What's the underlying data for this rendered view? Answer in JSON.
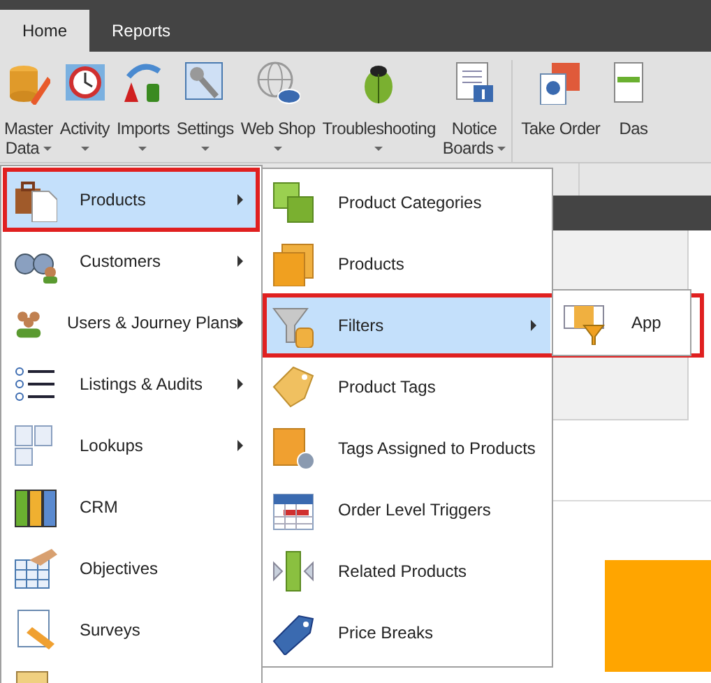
{
  "tabs": [
    {
      "label": "Home",
      "selected": true
    },
    {
      "label": "Reports",
      "selected": false
    }
  ],
  "ribbon": {
    "groups": [
      {
        "buttons": [
          {
            "lines": [
              "Master",
              "Data"
            ],
            "dropdown": true
          },
          {
            "lines": [
              "Activity"
            ],
            "dropdown": true
          },
          {
            "lines": [
              "Imports"
            ],
            "dropdown": true
          },
          {
            "lines": [
              "Settings"
            ],
            "dropdown": true
          },
          {
            "lines": [
              "Web Shop"
            ],
            "dropdown": true
          },
          {
            "lines": [
              "Troubleshooting"
            ],
            "dropdown": true
          },
          {
            "lines": [
              "Notice",
              "Boards"
            ],
            "dropdown": true
          }
        ]
      },
      {
        "buttons": [
          {
            "lines": [
              "Take Order"
            ],
            "dropdown": false
          },
          {
            "lines": [
              "Das"
            ],
            "dropdown": false
          }
        ]
      }
    ]
  },
  "menu": {
    "items": [
      {
        "label": "Products",
        "selected": true,
        "submenu": true,
        "highlighted": true
      },
      {
        "label": "Customers",
        "selected": false,
        "submenu": true,
        "highlighted": false
      },
      {
        "label": "Users & Journey Plans",
        "selected": false,
        "submenu": true,
        "highlighted": false
      },
      {
        "label": "Listings & Audits",
        "selected": false,
        "submenu": true,
        "highlighted": false
      },
      {
        "label": "Lookups",
        "selected": false,
        "submenu": true,
        "highlighted": false
      },
      {
        "label": "CRM",
        "selected": false,
        "submenu": false,
        "highlighted": false
      },
      {
        "label": "Objectives",
        "selected": false,
        "submenu": false,
        "highlighted": false
      },
      {
        "label": "Surveys",
        "selected": false,
        "submenu": false,
        "highlighted": false
      }
    ]
  },
  "submenu": {
    "items": [
      {
        "label": "Product Categories",
        "selected": false,
        "submenu": false,
        "highlighted": false
      },
      {
        "label": "Products",
        "selected": false,
        "submenu": false,
        "highlighted": false
      },
      {
        "label": "Filters",
        "selected": true,
        "submenu": true,
        "highlighted": true
      },
      {
        "label": "Product Tags",
        "selected": false,
        "submenu": false,
        "highlighted": false
      },
      {
        "label": "Tags Assigned to Products",
        "selected": false,
        "submenu": false,
        "highlighted": false
      },
      {
        "label": "Order Level Triggers",
        "selected": false,
        "submenu": false,
        "highlighted": false
      },
      {
        "label": "Related Products",
        "selected": false,
        "submenu": false,
        "highlighted": false
      },
      {
        "label": "Price Breaks",
        "selected": false,
        "submenu": false,
        "highlighted": false
      }
    ]
  },
  "flyout": {
    "items": [
      {
        "label": "App",
        "selected": false
      }
    ]
  }
}
